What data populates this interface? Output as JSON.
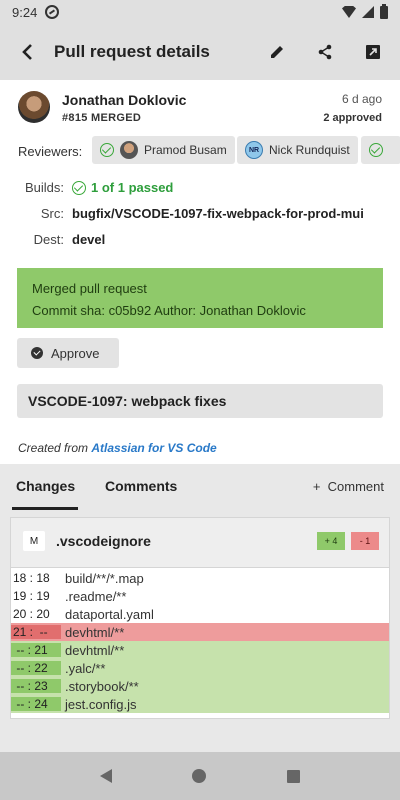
{
  "status": {
    "time": "9:24"
  },
  "app_bar": {
    "title": "Pull request details"
  },
  "pr": {
    "author": "Jonathan Doklovic",
    "meta": "#815  MERGED",
    "ago": "6 d ago",
    "approved": "2 approved"
  },
  "reviewers": {
    "label": "Reviewers:",
    "items": [
      {
        "name": "Pramod Busam",
        "approved": true
      },
      {
        "name": "Nick Rundquist",
        "approved": false,
        "initials": "NR"
      }
    ]
  },
  "details": {
    "builds_label": "Builds:",
    "builds_value": "1 of 1 passed",
    "src_label": "Src:",
    "src_value": "bugfix/VSCODE-1097-fix-webpack-for-prod-mui",
    "dest_label": "Dest:",
    "dest_value": "devel"
  },
  "merged": {
    "line1": "Merged pull request",
    "line2": "Commit sha: c05b92  Author: Jonathan Doklovic"
  },
  "approve_label": "Approve",
  "pr_title": "VSCODE-1097: webpack fixes",
  "created_prefix": "Created from ",
  "created_link": "Atlassian for VS Code",
  "tabs": {
    "changes": "Changes",
    "comments": "Comments",
    "comment_action": "Comment"
  },
  "file": {
    "badge": "M",
    "name": ".vscodeignore",
    "plus": "+ 4",
    "minus": "- 1",
    "rows": [
      {
        "ln": "18 : 18",
        "code": "build/**/*.map",
        "type": "ctx"
      },
      {
        "ln": "19 : 19",
        "code": ".readme/**",
        "type": "ctx"
      },
      {
        "ln": "20 : 20",
        "code": "dataportal.yaml",
        "type": "ctx"
      },
      {
        "ln": "21 :  --",
        "code": "devhtml/**",
        "type": "removed"
      },
      {
        "ln": " -- : 21",
        "code": "devhtml/**",
        "type": "added"
      },
      {
        "ln": " -- : 22",
        "code": ".yalc/**",
        "type": "added"
      },
      {
        "ln": " -- : 23",
        "code": ".storybook/**",
        "type": "added"
      },
      {
        "ln": " -- : 24",
        "code": "jest.config.js",
        "type": "added"
      }
    ]
  }
}
